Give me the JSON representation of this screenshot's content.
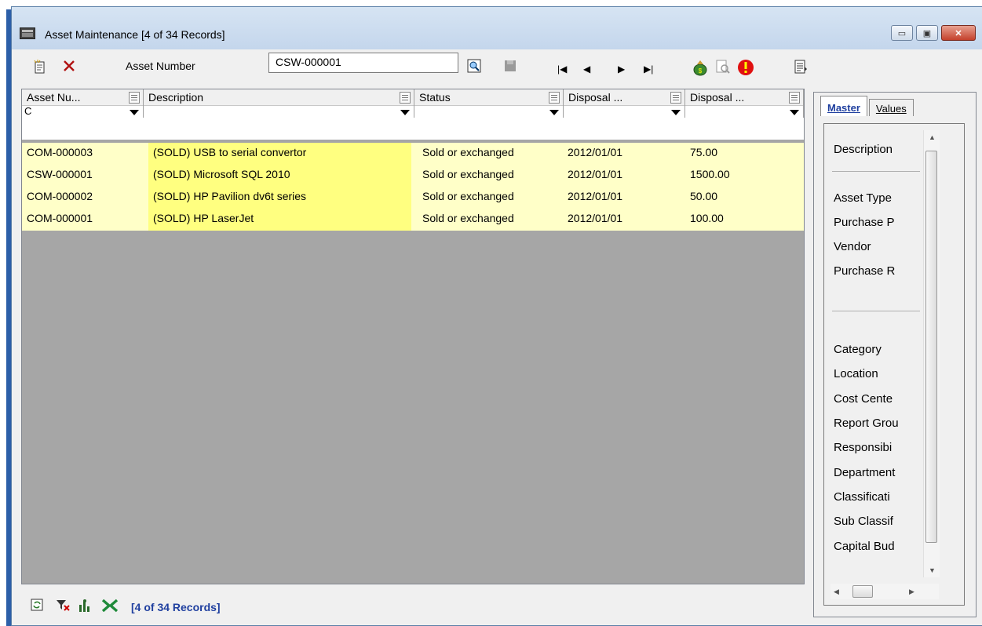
{
  "window": {
    "title": "Asset Maintenance [4 of 34 Records]"
  },
  "titlebar_buttons": {
    "minimize": "▭",
    "maximize": "▣",
    "close": "✕"
  },
  "toolbar": {
    "new_icon": "new-record-icon",
    "delete_icon": "delete-icon",
    "asset_label": "Asset Number",
    "asset_value": "CSW-000001",
    "lookup_icon": "lookup-icon",
    "save_icon": "save-icon",
    "nav_first": "|◀",
    "nav_prev": "◀",
    "nav_next": "▶",
    "nav_last": "▶|",
    "tool_icons": [
      "asset-bag-icon",
      "preview-icon",
      "alert-icon",
      "report-icon"
    ]
  },
  "grid": {
    "columns": [
      {
        "label": "Asset Nu...",
        "filter": "C"
      },
      {
        "label": "Description",
        "filter": ""
      },
      {
        "label": "Status",
        "filter": ""
      },
      {
        "label": "Disposal ...",
        "filter": ""
      },
      {
        "label": "Disposal ...",
        "filter": ""
      }
    ],
    "rows": [
      {
        "asset": "COM-000003",
        "description": "(SOLD) USB to serial convertor",
        "status": "Sold or exchanged",
        "date": "2012/01/01",
        "amount": "75.00"
      },
      {
        "asset": "CSW-000001",
        "description": "(SOLD) Microsoft SQL 2010",
        "status": "Sold or exchanged",
        "date": "2012/01/01",
        "amount": "1500.00"
      },
      {
        "asset": "COM-000002",
        "description": "(SOLD) HP Pavilion dv6t series",
        "status": "Sold or exchanged",
        "date": "2012/01/01",
        "amount": "50.00"
      },
      {
        "asset": "COM-000001",
        "description": "(SOLD) HP LaserJet",
        "status": "Sold or exchanged",
        "date": "2012/01/01",
        "amount": "100.00"
      }
    ]
  },
  "statusbar": {
    "icons": [
      "refresh-icon",
      "clear-filter-icon",
      "chart-icon",
      "excel-icon"
    ],
    "records": "[4 of 34 Records]"
  },
  "side": {
    "tabs": [
      "Master",
      "Values"
    ],
    "fields": [
      "Description",
      "Asset Type",
      "Purchase P",
      "Vendor",
      "Purchase R",
      "Category",
      "Location",
      "Cost Cente",
      "Report Grou",
      "Responsibi",
      "Department",
      "Classificati",
      "Sub Classif",
      "Capital Bud"
    ]
  },
  "colors": {
    "row_bg": "#ffffc8",
    "description_bg": "#ffff80",
    "grid_empty": "#a6a6a6",
    "accent": "#1f3f9f"
  }
}
